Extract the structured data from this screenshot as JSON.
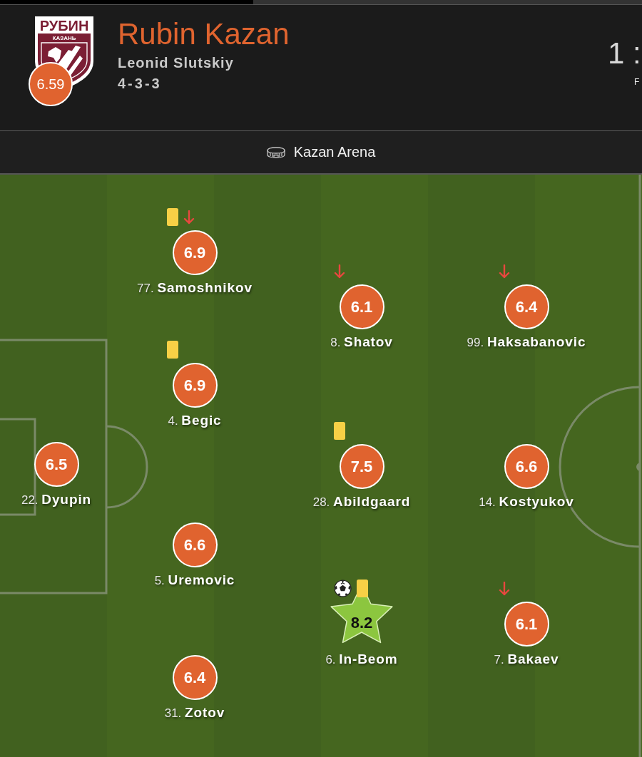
{
  "team": {
    "name": "Rubin Kazan",
    "manager": "Leonid Slutskiy",
    "formation": "4-3-3",
    "rating": "6.59",
    "crest": {
      "wordmark": "РУБИН",
      "city": "КАЗАНЬ"
    }
  },
  "score": {
    "text": "1 :",
    "status": "F"
  },
  "venue": {
    "name": "Kazan Arena"
  },
  "lineup": {
    "lines": [
      {
        "players": [
          {
            "label": "22. **Dyupin**",
            "rating": "6.5",
            "top_rated": false
          }
        ]
      },
      {
        "players": [
          {
            "label": "77. **Samoshnikov**",
            "rating": "6.9",
            "top_rated": false,
            "events": [
              {
                "kind": "yellow_card"
              },
              {
                "kind": "sub_off"
              }
            ]
          },
          {
            "label": "4. **Begic**",
            "rating": "6.9",
            "top_rated": false,
            "events": [
              {
                "kind": "yellow_card"
              }
            ]
          },
          {
            "label": "5. **Uremovic**",
            "rating": "6.6",
            "top_rated": false
          },
          {
            "label": "31. **Zotov**",
            "rating": "6.4",
            "top_rated": false
          }
        ]
      },
      {
        "players": [
          {
            "label": "8. **Shatov**",
            "rating": "6.1",
            "top_rated": false,
            "events": [
              {
                "kind": "sub_off"
              }
            ]
          },
          {
            "label": "28. **Abildgaard**",
            "rating": "7.5",
            "top_rated": false,
            "events": [
              {
                "kind": "yellow_card"
              }
            ]
          },
          {
            "label": "6. **In-Beom**",
            "rating": "8.2",
            "top_rated": true,
            "events": [
              {
                "kind": "goal"
              },
              {
                "kind": "yellow_card"
              }
            ]
          }
        ]
      },
      {
        "players": [
          {
            "label": "99. **Haksabanovic**",
            "rating": "6.4",
            "top_rated": false,
            "events": [
              {
                "kind": "sub_off"
              }
            ]
          },
          {
            "label": "14. **Kostyukov**",
            "rating": "6.6",
            "top_rated": false
          },
          {
            "label": "7. **Bakaev**",
            "rating": "6.1",
            "top_rated": false,
            "events": [
              {
                "kind": "sub_off"
              }
            ]
          }
        ]
      }
    ]
  }
}
